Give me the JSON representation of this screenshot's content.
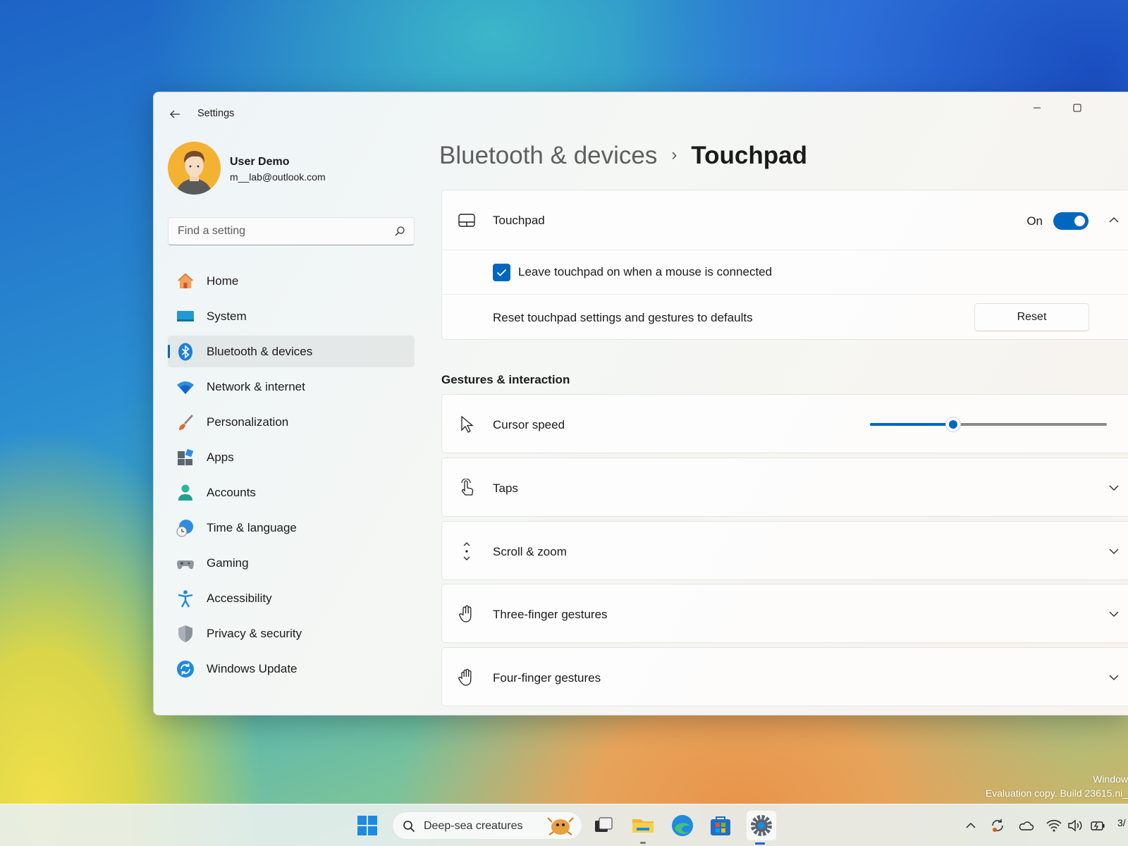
{
  "window": {
    "title": "Settings",
    "back_icon": "back-arrow-icon",
    "minimize_icon": "minimize-icon",
    "maximize_icon": "maximize-icon"
  },
  "user": {
    "name": "User Demo",
    "email": "m__lab@outlook.com"
  },
  "search": {
    "placeholder": "Find a setting",
    "value": ""
  },
  "sidebar": {
    "active_index": 2,
    "items": [
      {
        "label": "Home",
        "icon": "home-icon"
      },
      {
        "label": "System",
        "icon": "system-icon"
      },
      {
        "label": "Bluetooth & devices",
        "icon": "bluetooth-icon"
      },
      {
        "label": "Network & internet",
        "icon": "wifi-icon"
      },
      {
        "label": "Personalization",
        "icon": "brush-icon"
      },
      {
        "label": "Apps",
        "icon": "apps-icon"
      },
      {
        "label": "Accounts",
        "icon": "accounts-icon"
      },
      {
        "label": "Time & language",
        "icon": "time-language-icon"
      },
      {
        "label": "Gaming",
        "icon": "gamepad-icon"
      },
      {
        "label": "Accessibility",
        "icon": "accessibility-icon"
      },
      {
        "label": "Privacy & security",
        "icon": "shield-icon"
      },
      {
        "label": "Windows Update",
        "icon": "update-icon"
      }
    ]
  },
  "breadcrumb": {
    "parent": "Bluetooth & devices",
    "separator": "›",
    "current": "Touchpad"
  },
  "touchpad_card": {
    "label": "Touchpad",
    "toggle_state": "On",
    "toggle_on": true,
    "leave_on_label": "Leave touchpad on when a mouse is connected",
    "leave_on_checked": true,
    "reset_description": "Reset touchpad settings and gestures to defaults",
    "reset_button": "Reset"
  },
  "gestures": {
    "section_title": "Gestures & interaction",
    "cursor_speed": {
      "label": "Cursor speed",
      "value_fraction": 0.35
    },
    "rows": [
      {
        "label": "Taps",
        "icon": "tap-icon"
      },
      {
        "label": "Scroll & zoom",
        "icon": "scroll-zoom-icon"
      },
      {
        "label": "Three-finger gestures",
        "icon": "three-finger-icon"
      },
      {
        "label": "Four-finger gestures",
        "icon": "four-finger-icon"
      }
    ]
  },
  "watermark": {
    "line1": "Window",
    "line2": "Evaluation copy. Build 23615.ni_"
  },
  "taskbar": {
    "search_text": "Deep-sea creatures",
    "clock_fragment": "3/",
    "apps": [
      "task-view-icon",
      "file-explorer-icon",
      "edge-icon",
      "store-icon",
      "settings-icon"
    ],
    "tray": [
      "chevron-up-icon",
      "sync-icon",
      "onedrive-icon",
      "wifi-icon",
      "volume-icon",
      "battery-icon"
    ]
  },
  "colors": {
    "accent": "#0067c0"
  }
}
